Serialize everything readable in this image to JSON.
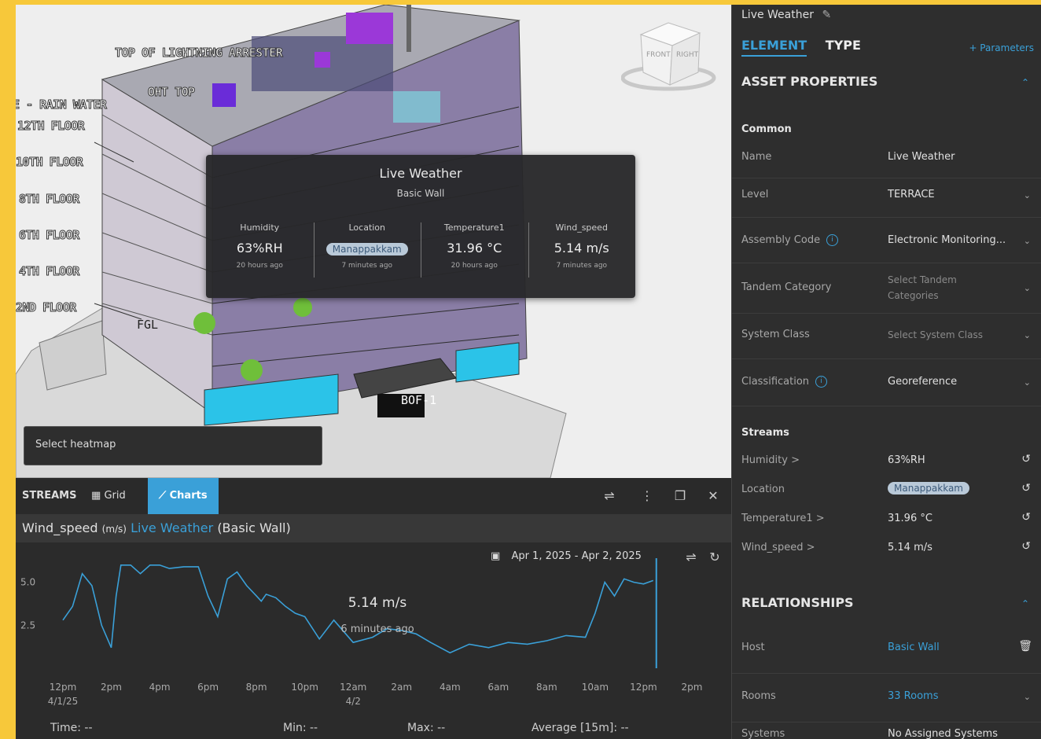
{
  "viewport": {
    "level_labels": [
      "TOP OF LIGHTNING ARRESTER",
      "OHT TOP",
      "E - RAIN WATER",
      "12TH FLOOR",
      "10TH FLOOR",
      "8TH FLOOR",
      "6TH FLOOR",
      "4TH FLOOR",
      "2ND FLOOR",
      "FGL",
      "BOF-1"
    ],
    "navcube": {
      "front": "FRONT",
      "right": "RIGHT"
    },
    "tooltip": {
      "title": "Live Weather",
      "subtitle": "Basic Wall",
      "cells": [
        {
          "label": "Humidity",
          "value": "63%RH",
          "ago": "20 hours ago"
        },
        {
          "label": "Location",
          "value": "Manappakkam",
          "ago": "7 minutes ago",
          "pill": true
        },
        {
          "label": "Temperature1",
          "value": "31.96 °C",
          "ago": "20 hours ago"
        },
        {
          "label": "Wind_speed",
          "value": "5.14 m/s",
          "ago": "7 minutes ago"
        }
      ]
    },
    "heatmap_placeholder": "Select heatmap"
  },
  "streams": {
    "label": "STREAMS",
    "grid_tab": "Grid",
    "charts_tab": "Charts",
    "header": {
      "stream": "Wind_speed",
      "unit": "(m/s)",
      "link": "Live Weather",
      "host": "(Basic Wall)"
    },
    "date_range": "Apr 1, 2025 - Apr 2, 2025",
    "footer": {
      "time": "Time: --",
      "min": "Min: --",
      "max": "Max: --",
      "avg": "Average [15m]: --"
    }
  },
  "chart_data": {
    "type": "line",
    "x_tick_labels": [
      "12pm",
      "2pm",
      "4pm",
      "6pm",
      "8pm",
      "10pm",
      "12am",
      "2am",
      "4am",
      "6am",
      "8am",
      "10am",
      "12pm",
      "2pm"
    ],
    "x_sub_labels": {
      "0": "4/1/25",
      "6": "4/2"
    },
    "y_ticks": [
      2.5,
      5.0
    ],
    "ylim": [
      0,
      6.4
    ],
    "series": [
      {
        "x": [
          0,
          0.2,
          0.4,
          0.6,
          0.8,
          1,
          1.1,
          1.2,
          1.4,
          1.6,
          1.8,
          2,
          2.2,
          2.5,
          2.8,
          3,
          3.2,
          3.4,
          3.6,
          3.8,
          4,
          4.1,
          4.2,
          4.4,
          4.6,
          4.8,
          5,
          5.3,
          5.6,
          6,
          6.4,
          6.7,
          7,
          7.3,
          7.6,
          8,
          8.4,
          8.8,
          9.2,
          9.6,
          10,
          10.4,
          10.8,
          11,
          11.2,
          11.4,
          11.6,
          11.8,
          12,
          12.2
        ],
        "values": [
          2.8,
          3.6,
          5.5,
          4.8,
          2.5,
          1.2,
          4.2,
          6.0,
          6.0,
          5.5,
          6.0,
          6.0,
          5.8,
          5.9,
          5.9,
          4.2,
          3.0,
          5.2,
          5.6,
          4.8,
          4.2,
          3.9,
          4.3,
          4.1,
          3.6,
          3.2,
          3.0,
          1.7,
          2.8,
          1.5,
          1.8,
          2.3,
          2.2,
          2.0,
          1.5,
          0.9,
          1.4,
          1.2,
          1.5,
          1.4,
          1.6,
          1.9,
          1.8,
          3.2,
          5.0,
          4.2,
          5.2,
          5.0,
          4.9,
          5.1
        ]
      }
    ],
    "current_value": "5.14 m/s",
    "current_ago": "6 minutes ago",
    "line_color": "#3aa0d8"
  },
  "side": {
    "window_title": "Live Weather",
    "tabs": {
      "element": "ELEMENT",
      "type": "TYPE"
    },
    "parameters": "+ Parameters",
    "asset_properties": "ASSET PROPERTIES",
    "common": "Common",
    "props": [
      {
        "key": "Name",
        "value": "Live Weather"
      },
      {
        "key": "Level",
        "value": "TERRACE"
      },
      {
        "key": "Assembly Code",
        "value": "Electronic Monitoring..."
      },
      {
        "key": "Tandem Category",
        "value": "Select Tandem Categories"
      },
      {
        "key": "System Class",
        "value": "Select System Class"
      },
      {
        "key": "Classification",
        "value": "Georeference"
      }
    ],
    "streams_title": "Streams",
    "streams": [
      {
        "key": "Humidity >",
        "value": "63%RH"
      },
      {
        "key": "Location",
        "value": "Manappakkam"
      },
      {
        "key": "Temperature1 >",
        "value": "31.96 °C"
      },
      {
        "key": "Wind_speed >",
        "value": "5.14 m/s"
      }
    ],
    "relationships": "RELATIONSHIPS",
    "rels": [
      {
        "key": "Host",
        "value": "Basic Wall"
      },
      {
        "key": "Rooms",
        "value": "33 Rooms"
      },
      {
        "key": "Systems",
        "value": "No Assigned Systems"
      }
    ]
  }
}
